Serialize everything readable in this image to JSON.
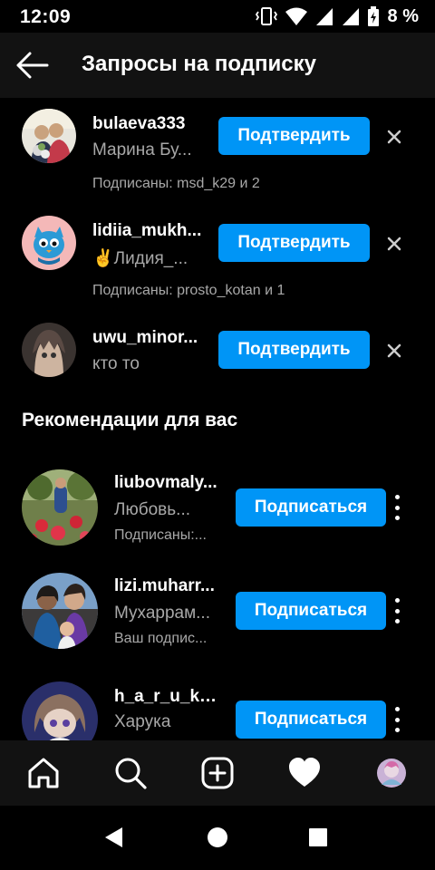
{
  "status_bar": {
    "time": "12:09",
    "battery": "8 %"
  },
  "header": {
    "title": "Запросы на подписку",
    "back_icon": "arrow-left-icon"
  },
  "requests": [
    {
      "username": "bulaeva333",
      "full_name": "Марина Бу...",
      "mutual": "Подписаны: msd_k29 и 2",
      "confirm": "Подтвердить"
    },
    {
      "username": "lidiia_mukh...",
      "full_name": "✌️Лидия_...",
      "mutual": "Подписаны: prosto_kotan и 1",
      "confirm": "Подтвердить"
    },
    {
      "username": "uwu_minor...",
      "full_name": "кто то",
      "mutual": "",
      "confirm": "Подтвердить"
    }
  ],
  "suggestions_title": "Рекомендации для вас",
  "suggestions": [
    {
      "username": "liubovmaly...",
      "full_name": "Любовь...",
      "sub": "Подписаны:...",
      "follow": "Подписаться"
    },
    {
      "username": "lizi.muharr...",
      "full_name": "Мухаррам...",
      "sub": "Ваш подпис...",
      "follow": "Подписаться"
    },
    {
      "username": "h_a_r_u_k_...",
      "full_name": "Харука",
      "sub": "",
      "follow": "Подписаться"
    }
  ],
  "colors": {
    "accent": "#0095f6",
    "background": "#000000",
    "secondary_text": "#a8a8a8",
    "bar": "#121212"
  },
  "tabs": [
    "home-icon",
    "search-icon",
    "add-post-icon",
    "heart-icon",
    "profile-avatar"
  ],
  "system_nav": [
    "back-triangle-icon",
    "home-circle-icon",
    "recents-square-icon"
  ]
}
